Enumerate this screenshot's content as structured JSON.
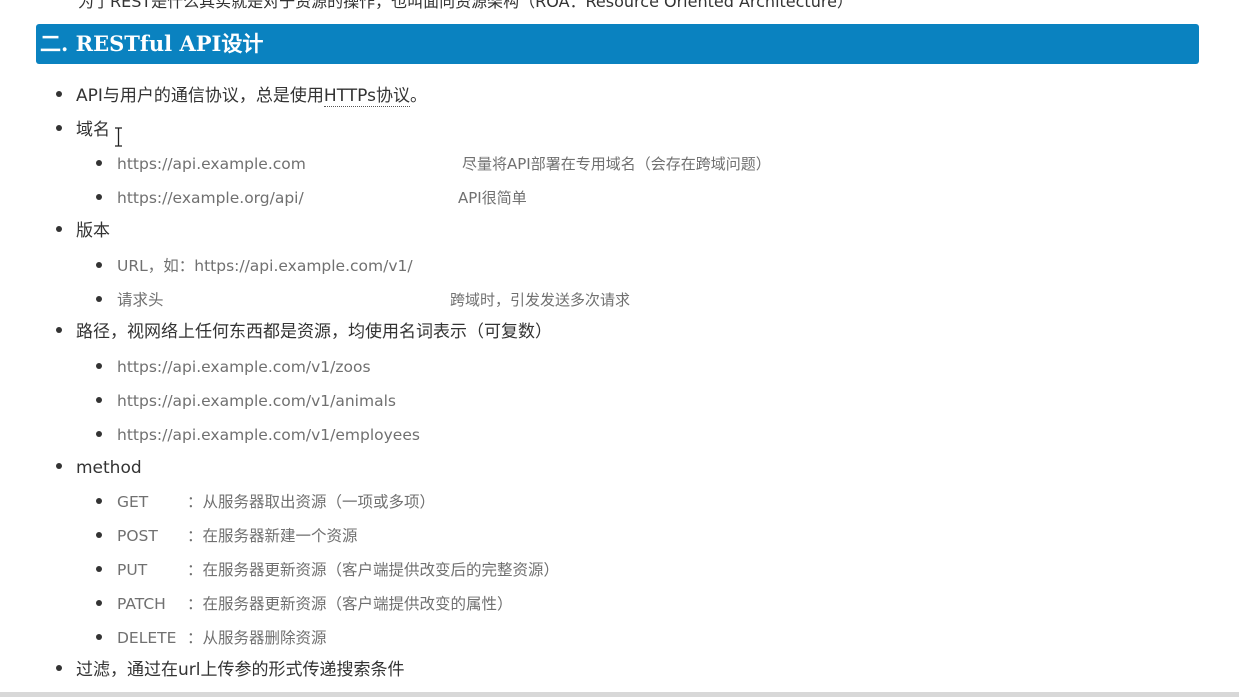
{
  "top_partial_text": "为了REST是什么其实就是对于资源的操作，也叫面向资源架构（ROA：Resource Oriented Architecture）",
  "section": {
    "title": "二. RESTful API设计"
  },
  "protocol": {
    "prefix": "API与用户的通信协议，总是使用",
    "term": "HTTPs协议",
    "suffix": "。"
  },
  "domain": {
    "label": "域名",
    "items": [
      {
        "url": "https://api.example.com",
        "note": "尽量将API部署在专用域名（会存在跨域问题）"
      },
      {
        "url": "https://example.org/api/",
        "note": "API很简单"
      }
    ]
  },
  "version": {
    "label": "版本",
    "items": [
      {
        "text": "URL，如：https://api.example.com/v1/",
        "note": ""
      },
      {
        "text": "请求头",
        "note": "跨域时，引发发送多次请求"
      }
    ]
  },
  "path": {
    "label": "路径，视网络上任何东西都是资源，均使用名词表示（可复数）",
    "items": [
      "https://api.example.com/v1/zoos",
      "https://api.example.com/v1/animals",
      "https://api.example.com/v1/employees"
    ]
  },
  "method": {
    "label": "method",
    "items": [
      {
        "name": "GET",
        "desc": "：从服务器取出资源（一项或多项）"
      },
      {
        "name": "POST",
        "desc": "：在服务器新建一个资源"
      },
      {
        "name": "PUT",
        "desc": "：在服务器更新资源（客户端提供改变后的完整资源）"
      },
      {
        "name": "PATCH",
        "desc": "：在服务器更新资源（客户端提供改变的属性）"
      },
      {
        "name": "DELETE",
        "desc": "：从服务器删除资源"
      }
    ]
  },
  "filter": {
    "label": "过滤，通过在url上传参的形式传递搜索条件"
  }
}
